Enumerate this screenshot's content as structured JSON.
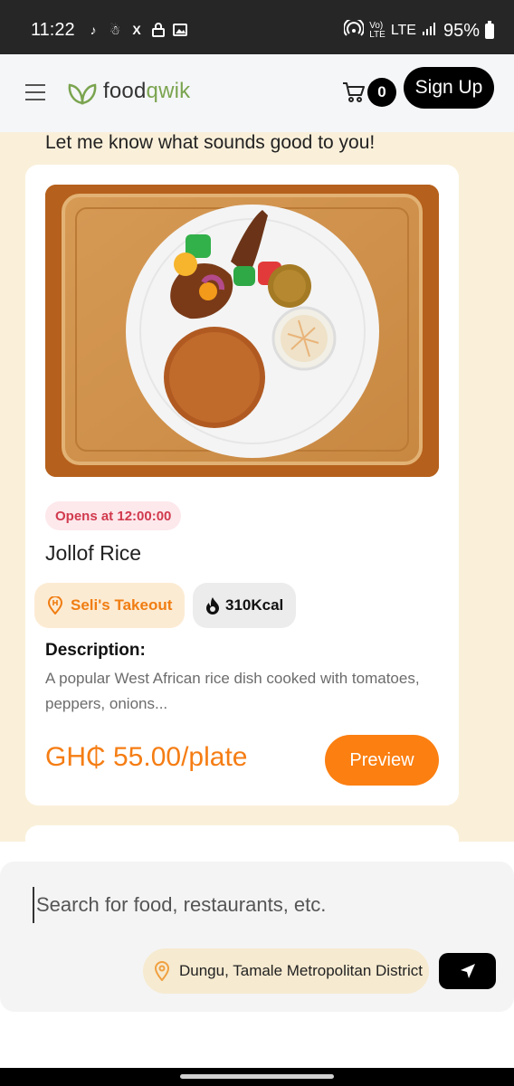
{
  "status_bar": {
    "time": "11:22",
    "network_top": "Vo)",
    "network_bottom": "LTE",
    "network_label": "LTE",
    "battery": "95%",
    "left_icons": [
      "tiktok-icon",
      "user-icon",
      "x-icon",
      "lock-icon",
      "image-icon"
    ],
    "right_icons": [
      "hotspot-icon",
      "signal-icon",
      "battery-icon"
    ]
  },
  "header": {
    "logo_prefix": "food",
    "logo_suffix": "qwik",
    "cart_count": "0",
    "signup_label": "Sign Up",
    "brand_color": "#7aa44f"
  },
  "main": {
    "prompt": "Let me know what sounds good to you!",
    "card": {
      "opens_label": "Opens at 12:00:00",
      "dish_name": "Jollof Rice",
      "restaurant": "Seli's Takeout",
      "calories": "310Kcal",
      "description_title": "Description:",
      "description": "A popular West African rice dish cooked with tomatoes, peppers, onions...",
      "price": "GH₵ 55.00/plate",
      "preview_label": "Preview",
      "accent_color": "#fb7f11"
    }
  },
  "search": {
    "placeholder": "Search for food, restaurants, etc.",
    "value": "",
    "location": "Dungu, Tamale Metropolitan District"
  }
}
